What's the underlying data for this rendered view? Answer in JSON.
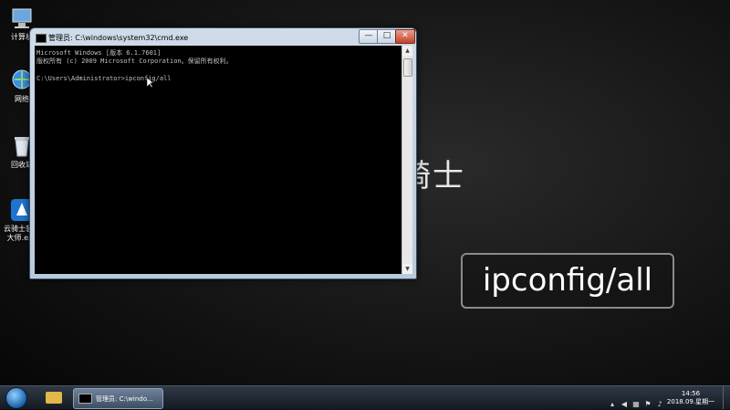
{
  "desktop": {
    "icons": [
      {
        "label": "计算机",
        "icon": "computer-icon"
      },
      {
        "label": "网络",
        "icon": "network-icon"
      },
      {
        "label": "回收站",
        "icon": "recycle-bin-icon"
      },
      {
        "label": "云骑士装机大师.exe",
        "icon": "yunqishi-app-icon"
      }
    ],
    "watermark": "骑士",
    "caption": "ipconfig/all"
  },
  "cmd_window": {
    "title": "管理员: C:\\windows\\system32\\cmd.exe",
    "controls": {
      "minimize": "—",
      "maximize": "□",
      "close": "✕"
    },
    "lines": [
      "Microsoft Windows [版本 6.1.7601]",
      "版权所有 (c) 2009 Microsoft Corporation。保留所有权利。",
      "",
      "C:\\Users\\Administrator>ipconfig/all"
    ]
  },
  "taskbar": {
    "start": "start-orb",
    "cmd_task_label": "管理员: C:\\windo...",
    "clock_time": "14:56",
    "clock_date": "2018.09.星期一"
  },
  "colors": {
    "console_bg": "#000000",
    "console_text": "#c0c0c0",
    "titlebar": "#c3d3e5"
  }
}
